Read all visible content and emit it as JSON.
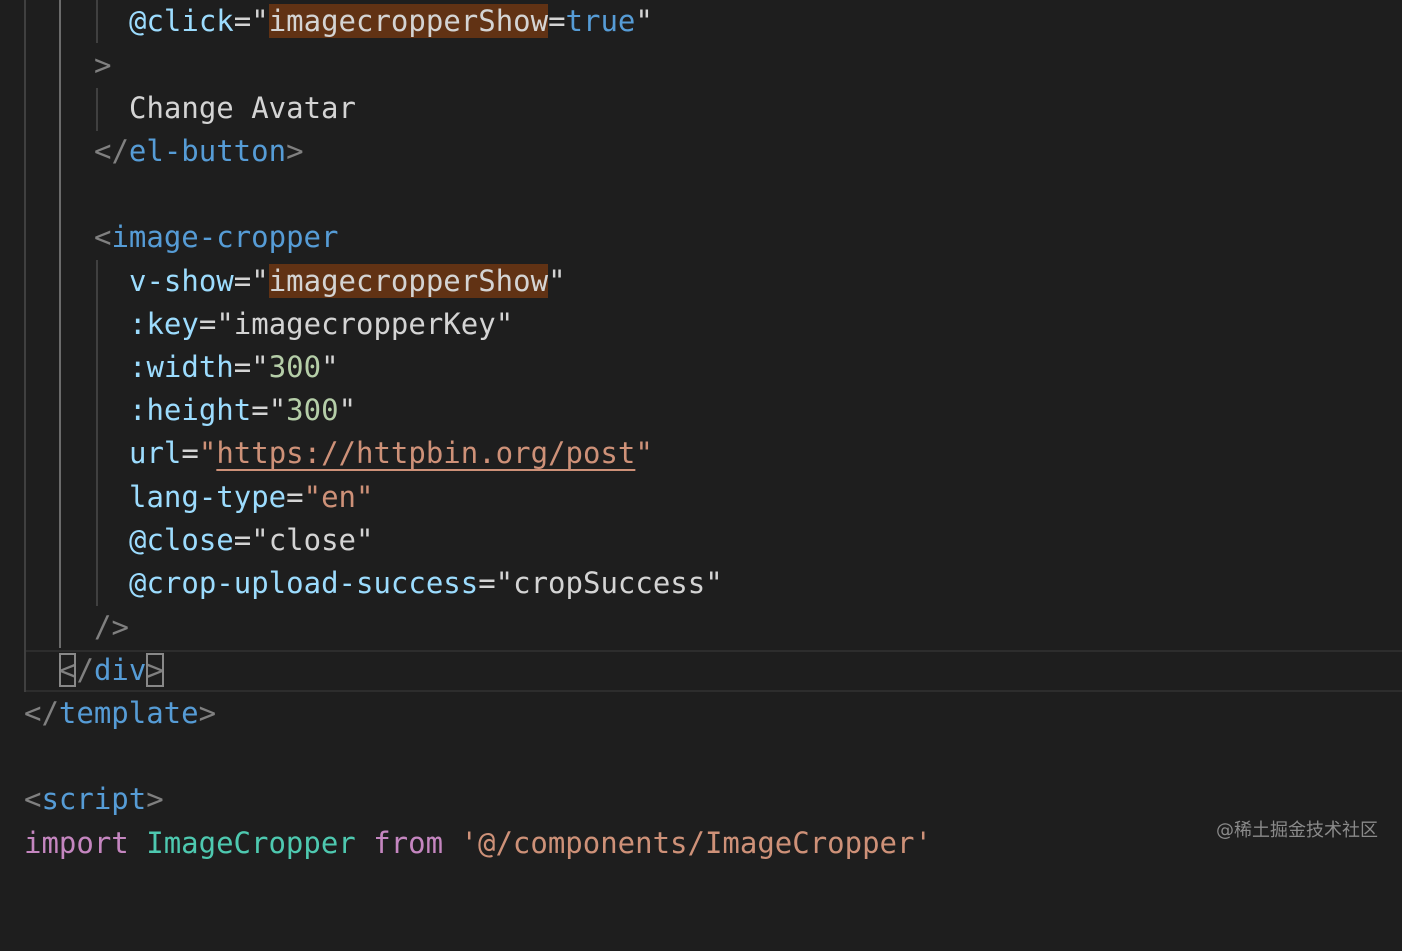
{
  "editor": {
    "lines": {
      "l1": {
        "at": "@",
        "attr": "click",
        "eq": "=",
        "q1": "\"",
        "hl": "imagecropperShow",
        "eq2": "=",
        "val": "true",
        "q2": "\""
      },
      "l2": {
        "gt": ">"
      },
      "l3": {
        "text": "Change Avatar"
      },
      "l4": {
        "open": "</",
        "tag": "el-button",
        "close": ">"
      },
      "l6": {
        "open": "<",
        "tag": "image-cropper"
      },
      "l7": {
        "attr": "v-show",
        "eq": "=",
        "q1": "\"",
        "hl": "imagecropperShow",
        "q2": "\""
      },
      "l8": {
        "colon": ":",
        "attr": "key",
        "eq": "=",
        "q1": "\"",
        "val": "imagecropperKey",
        "q2": "\""
      },
      "l9": {
        "colon": ":",
        "attr": "width",
        "eq": "=",
        "q1": "\"",
        "val": "300",
        "q2": "\""
      },
      "l10": {
        "colon": ":",
        "attr": "height",
        "eq": "=",
        "q1": "\"",
        "val": "300",
        "q2": "\""
      },
      "l11": {
        "attr": "url",
        "eq": "=",
        "q1": "\"",
        "val": "https://httpbin.org/post",
        "q2": "\""
      },
      "l12": {
        "attr": "lang-type",
        "eq": "=",
        "q1": "\"",
        "val": "en",
        "q2": "\""
      },
      "l13": {
        "at": "@",
        "attr": "close",
        "eq": "=",
        "q1": "\"",
        "val": "close",
        "q2": "\""
      },
      "l14": {
        "at": "@",
        "attr": "crop-upload-success",
        "eq": "=",
        "q1": "\"",
        "val": "cropSuccess",
        "q2": "\""
      },
      "l15": {
        "selfclose": "/>"
      },
      "l16": {
        "lt": "<",
        "slash": "/",
        "tag": "div",
        "gt": ">"
      },
      "l17": {
        "open": "</",
        "tag": "template",
        "close": ">"
      },
      "l19": {
        "open": "<",
        "tag": "script",
        "close": ">"
      },
      "l20": {
        "kw1": "import",
        "ident": "ImageCropper",
        "kw2": "from",
        "path": "'@/components/ImageCropper'"
      }
    }
  },
  "watermark": "@稀土掘金技术社区"
}
